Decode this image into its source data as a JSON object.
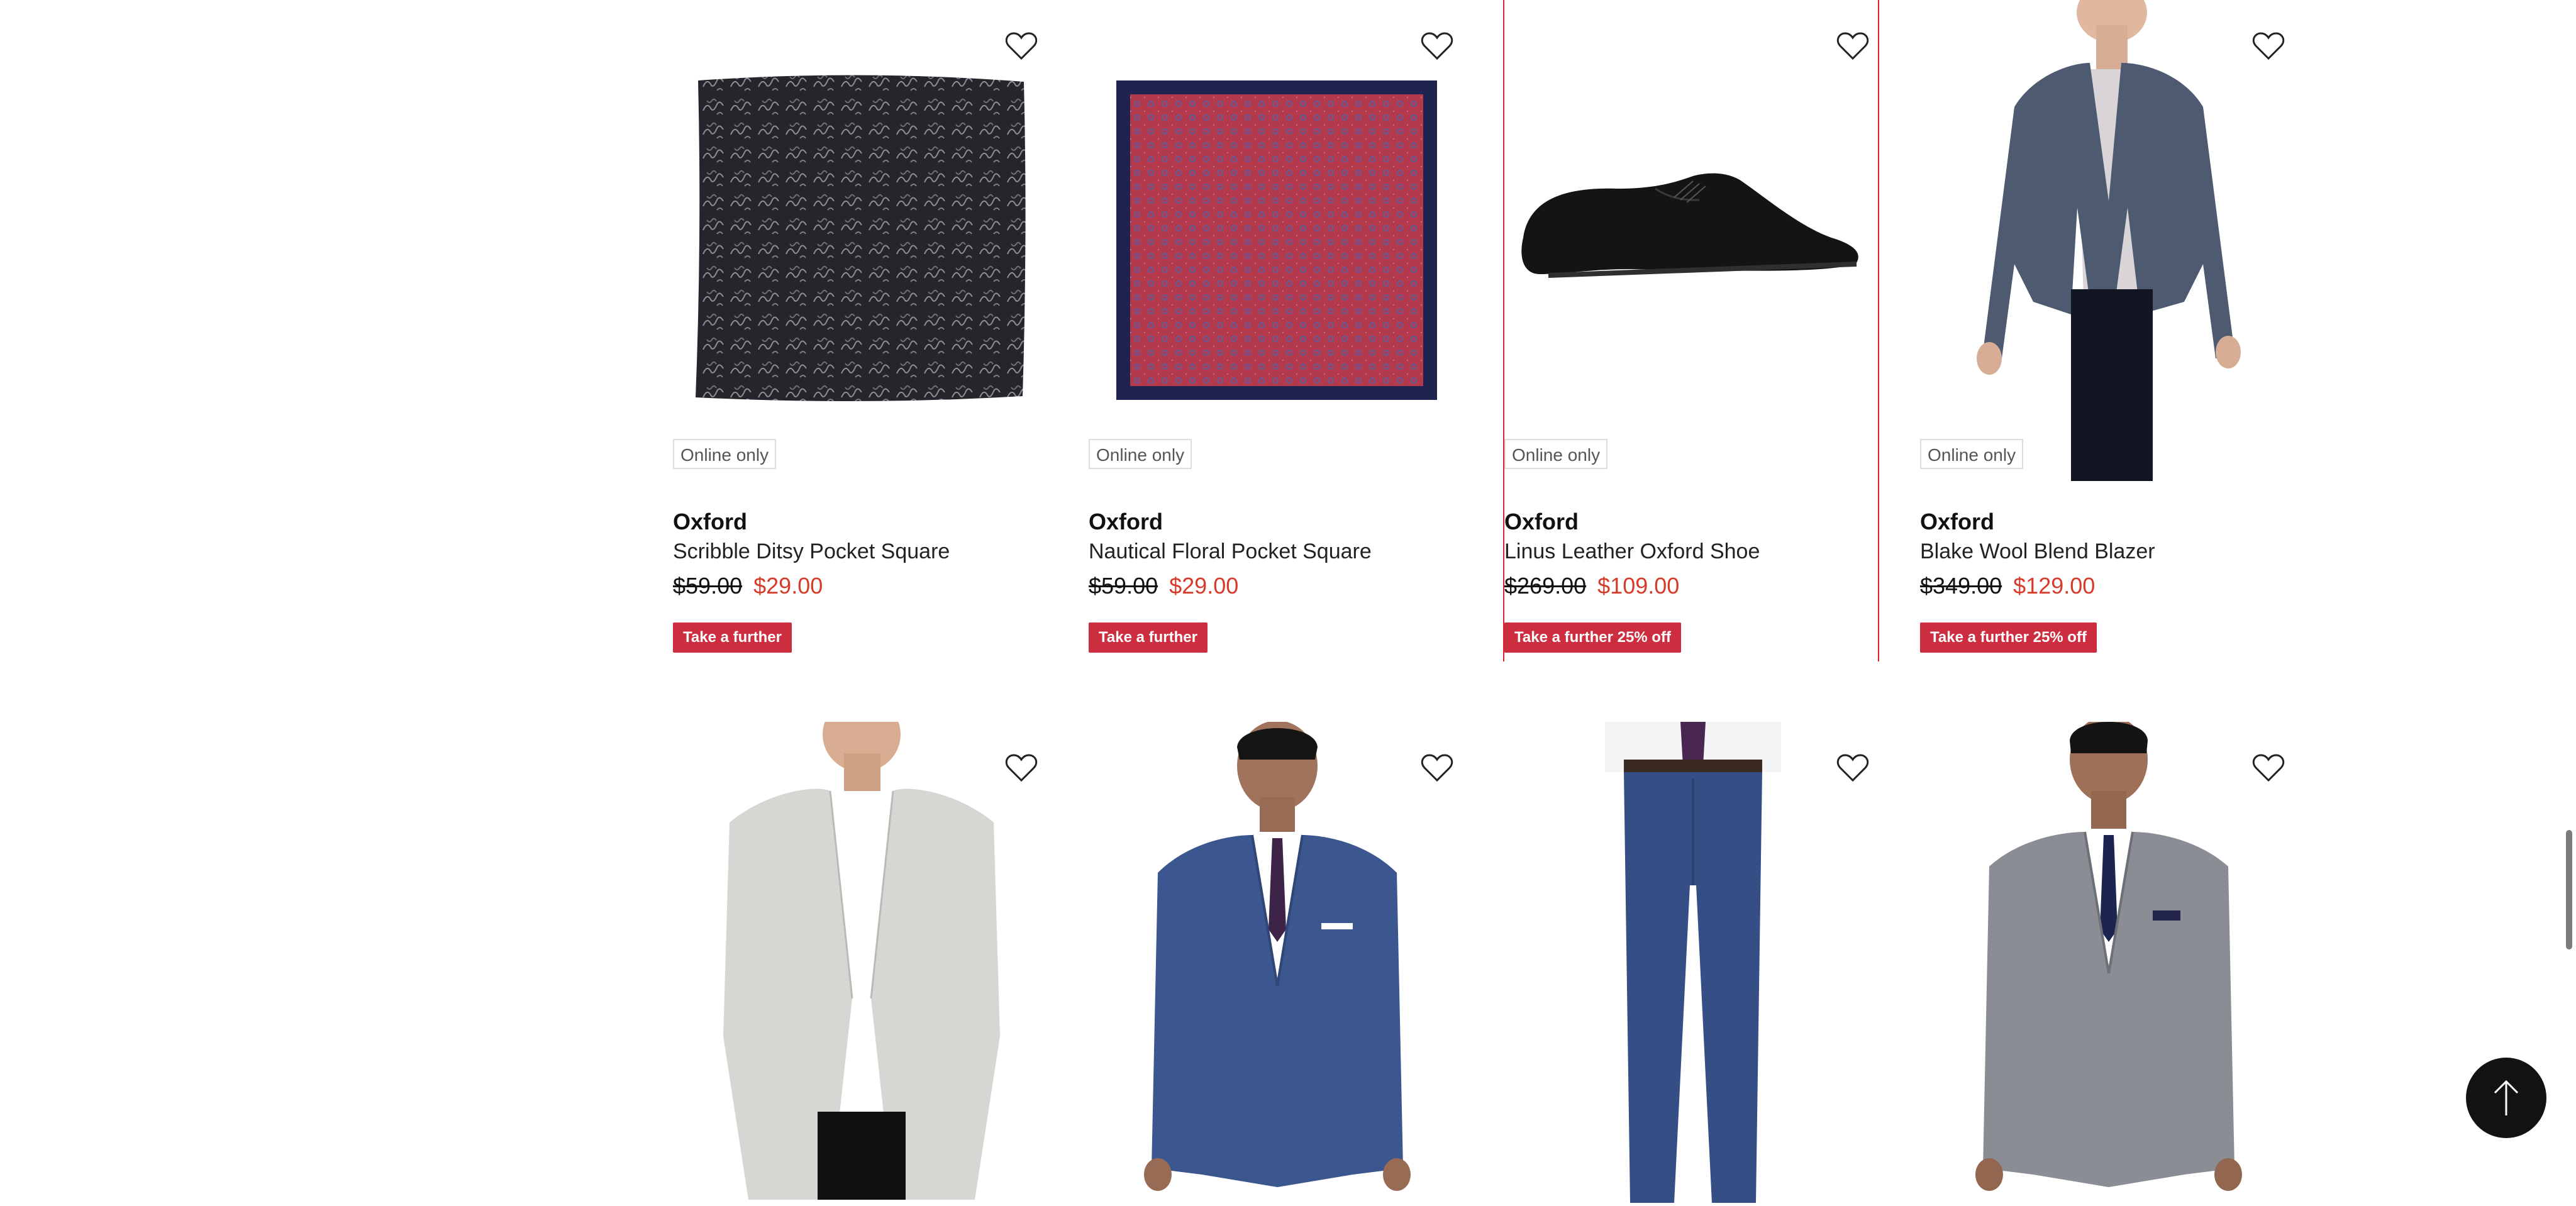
{
  "products": [
    {
      "badge": "Online only",
      "brand": "Oxford",
      "name": "Scribble Ditsy Pocket Square",
      "was_price": "$59.00",
      "now_price": "$29.00",
      "promo": "Take a further",
      "image": "pocket-square-dark-pattern"
    },
    {
      "badge": "Online only",
      "brand": "Oxford",
      "name": "Nautical Floral Pocket Square",
      "was_price": "$59.00",
      "now_price": "$29.00",
      "promo": "Take a further",
      "image": "pocket-square-red-navy"
    },
    {
      "badge": "Online only",
      "brand": "Oxford",
      "name": "Linus Leather Oxford Shoe",
      "was_price": "$269.00",
      "now_price": "$109.00",
      "promo": "Take a further 25% off",
      "image": "black-oxford-shoe"
    },
    {
      "badge": "Online only",
      "brand": "Oxford",
      "name": "Blake Wool Blend Blazer",
      "was_price": "$349.00",
      "now_price": "$129.00",
      "promo": "Take a further 25% off",
      "image": "navy-blazer-model"
    },
    {
      "image": "light-grey-blazer-model"
    },
    {
      "image": "blue-suit-model"
    },
    {
      "image": "blue-suit-trousers-model"
    },
    {
      "image": "grey-check-suit-model"
    }
  ],
  "colors": {
    "sale_price": "#d63b2a",
    "promo_bg": "#cc2e3f",
    "highlight": "#e0222b",
    "to_top_bg": "#121212"
  },
  "icons": {
    "favourite": "heart-outline-icon",
    "to_top": "arrow-up-icon"
  }
}
